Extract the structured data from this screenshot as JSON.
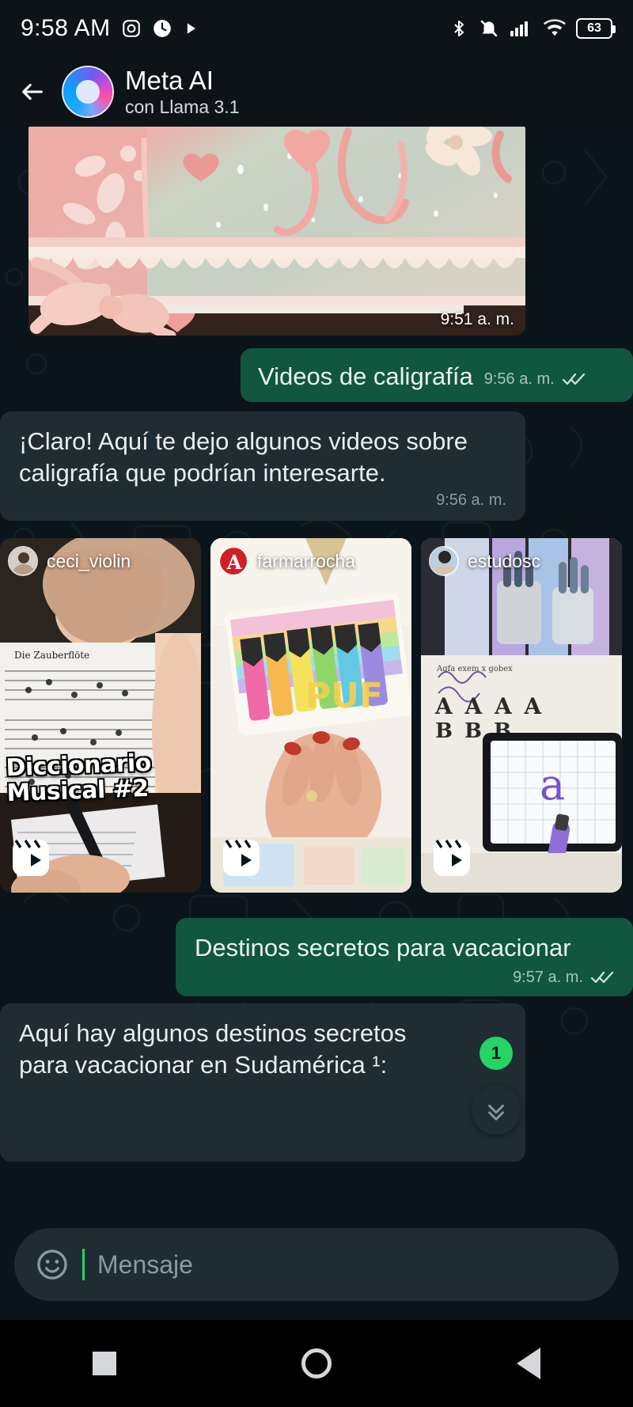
{
  "status_bar": {
    "time": "9:58 AM",
    "left_icons": [
      "instagram-icon",
      "clock-icon",
      "play-icon"
    ],
    "right_icons": [
      "bluetooth-icon",
      "mute-icon",
      "signal-icon",
      "wifi-icon"
    ],
    "battery_level": "63"
  },
  "header": {
    "back_label": "back-arrow",
    "title": "Meta AI",
    "subtitle": "con Llama 3.1"
  },
  "messages": [
    {
      "id": "image-message",
      "type": "image",
      "description": "pink handmade greeting card with lace ribbon and paper flowers",
      "time": "9:51 a. m."
    },
    {
      "id": "outgoing-1",
      "type": "outgoing",
      "text": "Videos de caligrafía",
      "time": "9:56 a. m.",
      "status": "read"
    },
    {
      "id": "incoming-1",
      "type": "incoming",
      "text": "¡Claro! Aquí te dejo algunos videos sobre caligrafía que podrían interesarte.",
      "time": "9:56 a. m."
    },
    {
      "id": "video-cards",
      "type": "cards"
    },
    {
      "id": "outgoing-2",
      "type": "outgoing",
      "text": "Destinos secretos para vacacionar",
      "time": "9:57 a. m.",
      "status": "read"
    },
    {
      "id": "incoming-2",
      "type": "incoming",
      "text": "Aquí hay algunos destinos secretos para vacacionar en Sudamérica ¹:",
      "time": ""
    }
  ],
  "video_cards": [
    {
      "username": "ceci_violin",
      "caption": "Diccionario\nMusical #2",
      "avatar": "photo-avatar",
      "media": "person writing in notebook wearing sheet-music t-shirt"
    },
    {
      "username": "farmarrocha",
      "caption": "",
      "avatar": "letter-a-avatar",
      "media": "hand with colorful brush pens on a notebook"
    },
    {
      "username": "estudosc",
      "caption": "",
      "avatar": "photo-avatar",
      "media": "tablet with lettering practice and pen holders"
    }
  ],
  "unread_badge": "1",
  "scroll_button": "chevron-down-icon",
  "composer": {
    "emoji_icon": "emoji-smiley-icon",
    "placeholder": "Mensaje",
    "value": ""
  },
  "nav_bar": {
    "recents": "square-icon",
    "home": "circle-icon",
    "back": "triangle-back-icon"
  },
  "colors": {
    "chat_bg": "#0b141a",
    "header_bg": "#0d1418",
    "incoming_bubble": "#1f2c33",
    "outgoing_bubble": "#115740",
    "accent_green": "#25d366",
    "text_primary": "#e9edef",
    "text_muted": "#8b9aa1"
  }
}
